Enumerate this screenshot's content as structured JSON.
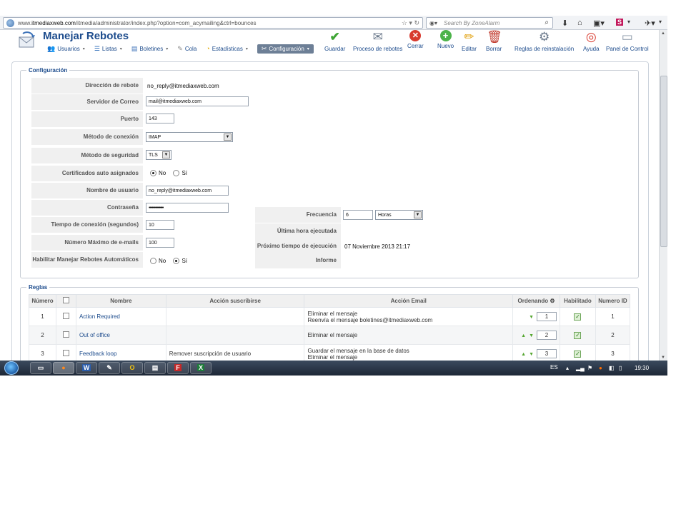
{
  "browser": {
    "url_prefix": "www.",
    "url_domain": "itmediaxweb.com",
    "url_path": "/itmedia/administrator/index.php?option=com_acymailing&ctrl=bounces",
    "search_placeholder": "Search By ZoneAlarm"
  },
  "header": {
    "title": "Manejar Rebotes",
    "menu": [
      {
        "label": "Usuarios",
        "icon": "users-icon"
      },
      {
        "label": "Listas",
        "icon": "lists-icon"
      },
      {
        "label": "Boletines",
        "icon": "newsletters-icon"
      },
      {
        "label": "Cola",
        "icon": "queue-icon"
      },
      {
        "label": "Estadísticas",
        "icon": "stats-icon"
      },
      {
        "label": "Configuración",
        "icon": "config-icon"
      }
    ],
    "toolbar": {
      "guardar": "Guardar",
      "proceso": "Proceso de rebotes",
      "cerrar": "Cerrar",
      "nuevo": "Nuevo",
      "editar": "Editar",
      "borrar": "Borrar",
      "reglas": "Reglas de reinstalación",
      "ayuda": "Ayuda",
      "panel": "Panel de Control"
    }
  },
  "config": {
    "legend": "Configuración",
    "labels": {
      "direccion": "Dirección de rebote",
      "servidor": "Servidor de Correo",
      "puerto": "Puerto",
      "metodo_conexion": "Método de conexión",
      "metodo_seguridad": "Método de seguridad",
      "certificados": "Certificados auto asignados",
      "usuario": "Nombre de usuario",
      "contrasena": "Contraseña",
      "tiempo": "Tiempo de conexión (segundos)",
      "max_emails": "Número Máximo de e-mails",
      "habilitar": "Habilitar Manejar Rebotes Automáticos",
      "frecuencia": "Frecuencia",
      "ultima_hora": "Última hora ejecutada",
      "proximo": "Próximo tiempo de ejecución",
      "informe": "Informe"
    },
    "values": {
      "direccion": "no_reply@itmediaxweb.com",
      "servidor": "mail@itmediaxweb.com",
      "puerto": "143",
      "metodo_conexion": "IMAP",
      "metodo_seguridad": "TLS",
      "usuario": "no_reply@itmediaxweb.com",
      "contrasena": "••••••••••••••",
      "tiempo": "10",
      "max_emails": "100",
      "frecuencia_num": "6",
      "frecuencia_unit": "Horas",
      "proximo": "07 Noviembre 2013 21:17"
    },
    "radio_no": "No",
    "radio_si": "Sí"
  },
  "rules": {
    "legend": "Reglas",
    "columns": [
      "Número",
      "",
      "Nombre",
      "Acción suscribirse",
      "Acción Email",
      "Ordenando",
      "Habilitado",
      "Numero ID"
    ],
    "rows": [
      {
        "num": "1",
        "name": "Action Required",
        "sub": "",
        "email1": "Eliminar el mensaje",
        "email2": "Reenvía el mensaje boletines@itmediaxweb.com",
        "order": "1",
        "id": "1"
      },
      {
        "num": "2",
        "name": "Out of office",
        "sub": "",
        "email1": "Eliminar el mensaje",
        "email2": "",
        "order": "2",
        "id": "2"
      },
      {
        "num": "3",
        "name": "Feedback loop",
        "sub": "Remover suscripción de usuario",
        "email1": "Guardar el mensaje en la base de datos",
        "email2": "Eliminar el mensaje",
        "order": "3",
        "id": "3"
      }
    ]
  },
  "taskbar": {
    "lang": "ES",
    "clock": "19:30"
  }
}
